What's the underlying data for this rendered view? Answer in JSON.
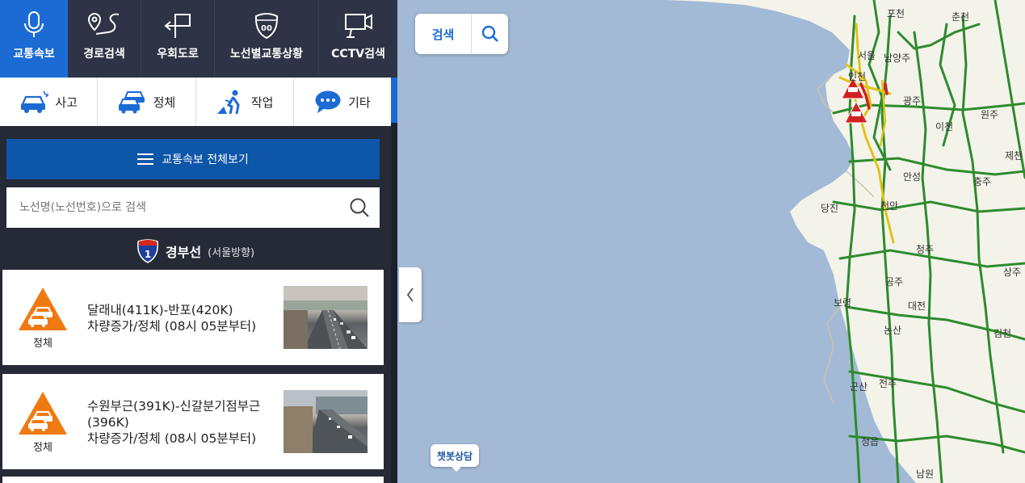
{
  "topnav": [
    {
      "label": "교통속보",
      "icon": "microphone-icon",
      "active": true
    },
    {
      "label": "경로검색",
      "icon": "route-icon"
    },
    {
      "label": "우회도로",
      "icon": "detour-icon"
    },
    {
      "label": "노선별교통상황",
      "icon": "highway-shield-icon"
    },
    {
      "label": "CCTV검색",
      "icon": "cctv-icon"
    }
  ],
  "categories": [
    {
      "label": "사고",
      "icon": "accident-car-icon"
    },
    {
      "label": "정체",
      "icon": "congestion-cars-icon"
    },
    {
      "label": "작업",
      "icon": "road-work-icon"
    },
    {
      "label": "기타",
      "icon": "chat-bubble-icon"
    }
  ],
  "viewall_label": "교통속보 전체보기",
  "search": {
    "placeholder": "노선명(노선번호)으로 검색"
  },
  "route": {
    "number": "1",
    "name": "경부선",
    "direction": "(서울방향)"
  },
  "incidents": [
    {
      "type": "정체",
      "line1": "달래내(411K)-반포(420K)",
      "line2": "차량증가/정체 (08시 05분부터)"
    },
    {
      "type": "정체",
      "line1": "수원부근(391K)-신갈분기점부근(396K)",
      "line2": "차량증가/정체 (08시 05분부터)"
    }
  ],
  "map": {
    "search_label": "검색",
    "chatbot_label": "챗봇상담",
    "cities": [
      {
        "name": "포천"
      },
      {
        "name": "춘천"
      },
      {
        "name": "서울"
      },
      {
        "name": "남양주"
      },
      {
        "name": "인천"
      },
      {
        "name": "광주"
      },
      {
        "name": "이천"
      },
      {
        "name": "원주"
      },
      {
        "name": "제천"
      },
      {
        "name": "안성"
      },
      {
        "name": "충주"
      },
      {
        "name": "당진"
      },
      {
        "name": "천안"
      },
      {
        "name": "청주"
      },
      {
        "name": "상주"
      },
      {
        "name": "공주"
      },
      {
        "name": "보령"
      },
      {
        "name": "대전"
      },
      {
        "name": "논산"
      },
      {
        "name": "김천"
      },
      {
        "name": "군산"
      },
      {
        "name": "전주"
      },
      {
        "name": "정읍"
      },
      {
        "name": "남원"
      }
    ]
  },
  "colors": {
    "accent": "#1c6bd5",
    "sidebar_bg": "#262a36",
    "nav_bg": "#2e3445",
    "viewall_bg": "#0e56a8",
    "incident_orange": "#f07a12",
    "sea": "#a3bad6",
    "land": "#f4f3ea",
    "road_green": "#2e8b2e",
    "road_yellow": "#e0c31a",
    "road_red": "#d32020"
  }
}
